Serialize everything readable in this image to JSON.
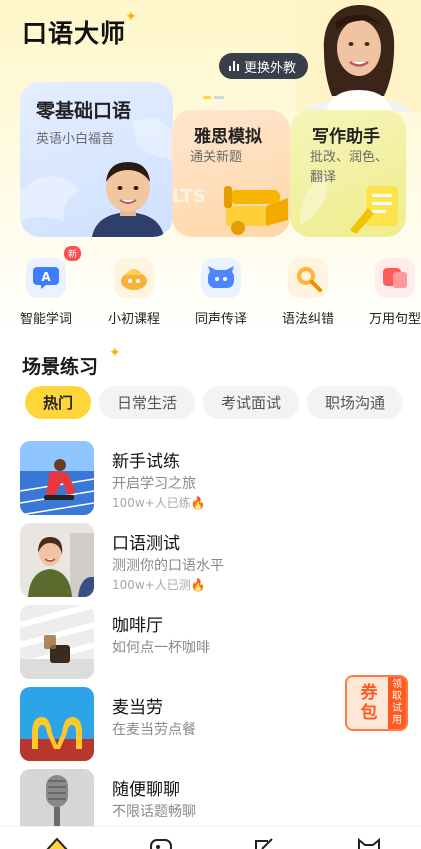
{
  "app": {
    "title": "口语大师"
  },
  "tutor": {
    "change_label": "更换外教"
  },
  "cards": [
    {
      "title": "零基础口语",
      "subtitle": "英语小白福音"
    },
    {
      "title": "雅思模拟",
      "subtitle": "通关新题",
      "watermark": "LTS"
    },
    {
      "title": "写作助手",
      "subtitle": "批改、润色、翻译"
    }
  ],
  "features": [
    {
      "label": "智能学词",
      "icon": "ai-words-icon",
      "badge": "新"
    },
    {
      "label": "小初课程",
      "icon": "course-icon"
    },
    {
      "label": "同声传译",
      "icon": "interpret-icon"
    },
    {
      "label": "语法纠错",
      "icon": "grammar-icon"
    },
    {
      "label": "万用句型",
      "icon": "sentence-icon"
    }
  ],
  "scene": {
    "title": "场景练习",
    "tabs": [
      "热门",
      "日常生活",
      "考试面试",
      "职场沟通"
    ],
    "items": [
      {
        "title": "新手试练",
        "subtitle": "开启学习之旅",
        "meta": "100w+人已练"
      },
      {
        "title": "口语测试",
        "subtitle": "测测你的口语水平",
        "meta": "100w+人已测"
      },
      {
        "title": "咖啡厅",
        "subtitle": "如何点一杯咖啡"
      },
      {
        "title": "麦当劳",
        "subtitle": "在麦当劳点餐"
      },
      {
        "title": "随便聊聊",
        "subtitle": "不限话题畅聊"
      }
    ]
  },
  "coupon": {
    "main": "券包",
    "side": "领取试用"
  },
  "colors": {
    "accent": "#ffd53a",
    "badge": "#ff4d4f",
    "coupon": "#ff5a1f"
  }
}
